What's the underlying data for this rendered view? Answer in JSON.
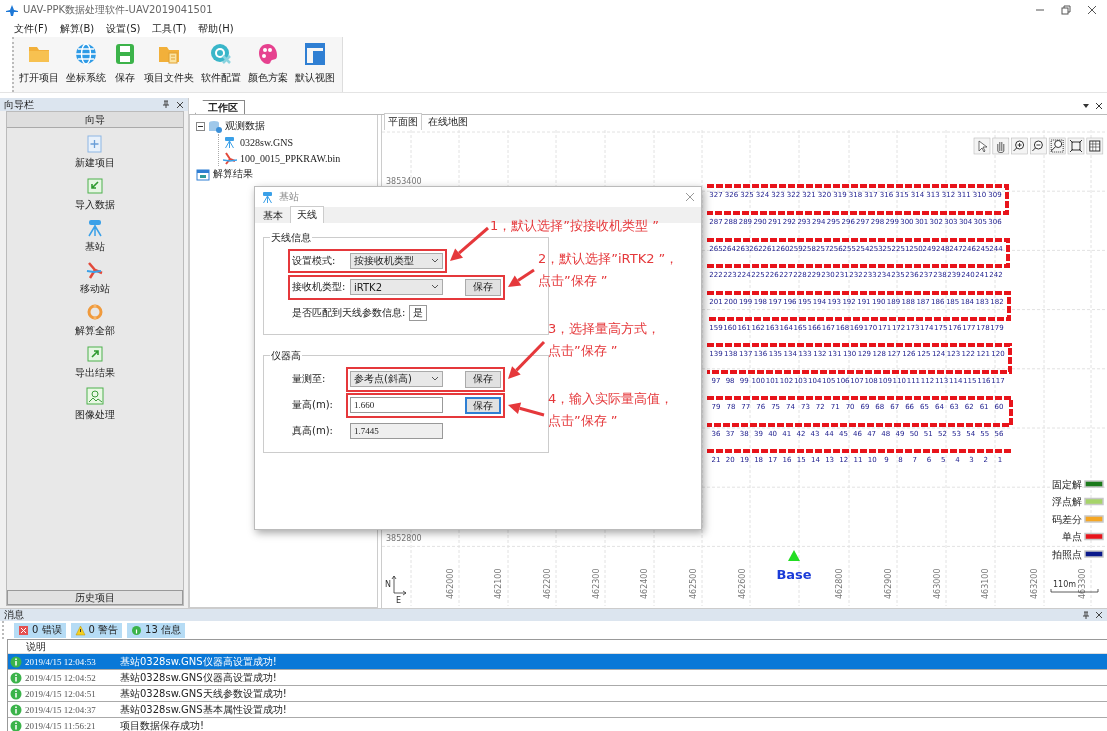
{
  "window": {
    "title": "UAV-PPK数据处理软件-UAV2019041501"
  },
  "menu": [
    "文件(F)",
    "解算(B)",
    "设置(S)",
    "工具(T)",
    "帮助(H)"
  ],
  "toolbar": [
    {
      "label": "打开项目",
      "kind": "folder"
    },
    {
      "label": "坐标系统",
      "kind": "globe"
    },
    {
      "label": "保存",
      "kind": "save"
    },
    {
      "label": "项目文件夹",
      "kind": "project-folder"
    },
    {
      "label": "软件配置",
      "kind": "config"
    },
    {
      "label": "颜色方案",
      "kind": "palette"
    },
    {
      "label": "默认视图",
      "kind": "layout"
    }
  ],
  "navigator": {
    "title": "向导栏",
    "header": "向导",
    "items": [
      {
        "label": "新建项目",
        "kind": "new"
      },
      {
        "label": "导入数据",
        "kind": "import"
      },
      {
        "label": "基站",
        "kind": "base"
      },
      {
        "label": "移动站",
        "kind": "rover"
      },
      {
        "label": "解算全部",
        "kind": "solve"
      },
      {
        "label": "导出结果",
        "kind": "export"
      },
      {
        "label": "图像处理",
        "kind": "image"
      }
    ],
    "footer": "历史项目"
  },
  "workspace": {
    "tab": "工作区",
    "tree": [
      {
        "label": "观测数据",
        "kind": "data",
        "expanded": true,
        "children": [
          {
            "label": "0328sw.GNS",
            "kind": "base"
          },
          {
            "label": "100_0015_PPKRAW.bin",
            "kind": "rover"
          }
        ]
      },
      {
        "label": "解算结果",
        "kind": "result"
      }
    ]
  },
  "map": {
    "tabs": [
      {
        "label": "平面图",
        "selected": true
      },
      {
        "label": "在线地图",
        "selected": false
      }
    ],
    "y_labels": [
      "3853400",
      "3852800"
    ],
    "x_labels": [
      "462000",
      "462100",
      "462200",
      "462300",
      "462400",
      "462500",
      "462600",
      "462800",
      "462900",
      "463000",
      "463100",
      "463200",
      "463300"
    ],
    "flight_strips": [
      {
        "labels": [
          "327",
          "326",
          "325",
          "324",
          "323",
          "322",
          "321",
          "320",
          "319",
          "318",
          "317",
          "316",
          "315",
          "314",
          "313",
          "312",
          "311",
          "310",
          "309"
        ]
      },
      {
        "labels": [
          "287",
          "288",
          "289",
          "290",
          "291",
          "292",
          "293",
          "294",
          "295",
          "296",
          "297",
          "298",
          "299",
          "300",
          "301",
          "302",
          "303",
          "304",
          "305",
          "306"
        ]
      },
      {
        "labels": [
          "265",
          "264",
          "263",
          "262",
          "261",
          "260",
          "259",
          "258",
          "257",
          "256",
          "255",
          "254",
          "253",
          "252",
          "251",
          "250",
          "249",
          "248",
          "247",
          "246",
          "245",
          "244"
        ]
      },
      {
        "labels": [
          "222",
          "223",
          "224",
          "225",
          "226",
          "227",
          "228",
          "229",
          "230",
          "231",
          "232",
          "233",
          "234",
          "235",
          "236",
          "237",
          "238",
          "239",
          "240",
          "241",
          "242"
        ]
      },
      {
        "labels": [
          "201",
          "200",
          "199",
          "198",
          "197",
          "196",
          "195",
          "194",
          "193",
          "192",
          "191",
          "190",
          "189",
          "188",
          "187",
          "186",
          "185",
          "184",
          "183",
          "182"
        ]
      },
      {
        "labels": [
          "159",
          "160",
          "161",
          "162",
          "163",
          "164",
          "165",
          "166",
          "167",
          "168",
          "169",
          "170",
          "171",
          "172",
          "173",
          "174",
          "175",
          "176",
          "177",
          "178",
          "179"
        ]
      },
      {
        "labels": [
          "139",
          "138",
          "137",
          "136",
          "135",
          "134",
          "133",
          "132",
          "131",
          "130",
          "129",
          "128",
          "127",
          "126",
          "125",
          "124",
          "123",
          "122",
          "121",
          "120"
        ]
      },
      {
        "labels": [
          "97",
          "98",
          "99",
          "100",
          "101",
          "102",
          "103",
          "104",
          "105",
          "106",
          "107",
          "108",
          "109",
          "110",
          "111",
          "112",
          "113",
          "114",
          "115",
          "116",
          "117"
        ]
      },
      {
        "labels": [
          "79",
          "78",
          "77",
          "76",
          "75",
          "74",
          "73",
          "72",
          "71",
          "70",
          "69",
          "68",
          "67",
          "66",
          "65",
          "64",
          "63",
          "62",
          "61",
          "60"
        ]
      },
      {
        "labels": [
          "36",
          "37",
          "38",
          "39",
          "40",
          "41",
          "42",
          "43",
          "44",
          "45",
          "46",
          "47",
          "48",
          "49",
          "50",
          "51",
          "52",
          "53",
          "54",
          "55",
          "56"
        ]
      },
      {
        "labels": [
          "21",
          "20",
          "19",
          "18",
          "17",
          "16",
          "15",
          "14",
          "13",
          "12",
          "11",
          "10",
          "9",
          "8",
          "7",
          "6",
          "5",
          "4",
          "3",
          "2",
          "1"
        ]
      }
    ],
    "base_label": "Base",
    "north": "N",
    "east": "E",
    "scale": "110m",
    "legend": [
      {
        "label": "固定解",
        "color": "#1b7a1b"
      },
      {
        "label": "浮点解",
        "color": "#a6d46a"
      },
      {
        "label": "码差分",
        "color": "#f5a623"
      },
      {
        "label": "单点",
        "color": "#e8141b"
      },
      {
        "label": "拍照点",
        "color": "#0b1a8c"
      }
    ]
  },
  "dialog": {
    "title": "基站",
    "tabs": [
      {
        "label": "基本",
        "selected": false
      },
      {
        "label": "天线",
        "selected": true
      }
    ],
    "groups": [
      {
        "title": "天线信息",
        "rows": [
          {
            "label": "设置模式:",
            "field": {
              "kind": "select",
              "value": "按接收机类型"
            }
          },
          {
            "label": "接收机类型:",
            "field": {
              "kind": "select",
              "value": "iRTK2"
            },
            "button": {
              "label": "保存",
              "focused": false
            }
          },
          {
            "label": "是否匹配到天线参数信息:",
            "field": {
              "kind": "flag",
              "value": "是"
            }
          }
        ]
      },
      {
        "title": "仪器高",
        "rows": [
          {
            "label": "量测至:",
            "field": {
              "kind": "select",
              "value": "参考点(斜高)"
            },
            "button": {
              "label": "保存",
              "focused": false
            }
          },
          {
            "label": "量高(m):",
            "field": {
              "kind": "input",
              "value": "1.660"
            },
            "button": {
              "label": "保存",
              "focused": true
            }
          },
          {
            "label": "真高(m):",
            "field": {
              "kind": "readonly",
              "value": "1.7445"
            }
          }
        ]
      }
    ]
  },
  "annotations": [
    {
      "lines": [
        "1，默认选择”按接收机类型 ”"
      ]
    },
    {
      "lines": [
        "2，默认选择”iRTK2 ”，",
        "点击”保存 ”"
      ]
    },
    {
      "lines": [
        "3，选择量高方式，",
        "点击”保存 ”"
      ]
    },
    {
      "lines": [
        "4，输入实际量高值，",
        "点击”保存 ”"
      ]
    }
  ],
  "messages": {
    "title": "消息",
    "filters": [
      {
        "label": "0 错误",
        "kind": "error",
        "on": true
      },
      {
        "label": "0 警告",
        "kind": "warning",
        "on": true
      },
      {
        "label": "13 信息",
        "kind": "info",
        "on": true
      }
    ],
    "columns": [
      "说明"
    ],
    "rows": [
      {
        "time": "2019/4/15 12:04:53",
        "text": "基站0328sw.GNS仪器高设置成功!",
        "selected": true
      },
      {
        "time": "2019/4/15 12:04:52",
        "text": "基站0328sw.GNS仪器高设置成功!",
        "selected": false
      },
      {
        "time": "2019/4/15 12:04:51",
        "text": "基站0328sw.GNS天线参数设置成功!",
        "selected": false
      },
      {
        "time": "2019/4/15 12:04:37",
        "text": "基站0328sw.GNS基本属性设置成功!",
        "selected": false
      },
      {
        "time": "2019/4/15 11:56:21",
        "text": "项目数据保存成功!",
        "selected": false
      }
    ]
  }
}
